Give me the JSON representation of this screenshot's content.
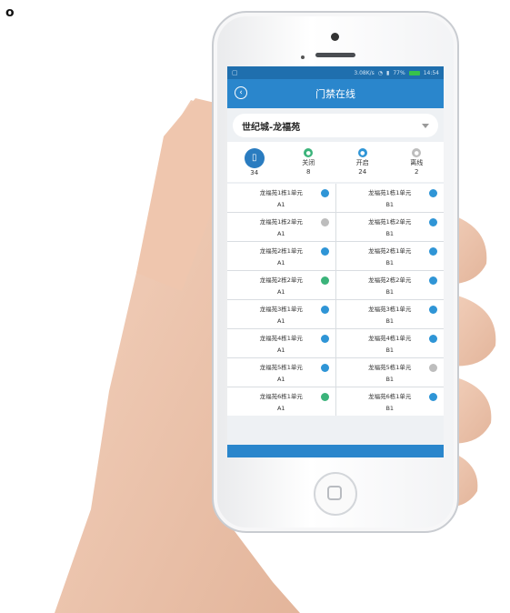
{
  "corner_mark": "o",
  "statusbar": {
    "speed": "3.08K/s",
    "battery_pct": "77%",
    "time": "14:54"
  },
  "navbar": {
    "title": "门禁在线",
    "back_icon": "back-circle-icon"
  },
  "selector": {
    "value": "世纪城-龙福苑"
  },
  "stats": {
    "total": {
      "count": "34",
      "icon": "door-icon"
    },
    "closed": {
      "label": "关闭",
      "count": "8"
    },
    "open": {
      "label": "开启",
      "count": "24"
    },
    "offline": {
      "label": "离线",
      "count": "2"
    }
  },
  "colors": {
    "navbar": "#2a86cc",
    "status_closed": "#3bb37a",
    "status_open": "#2f95d6",
    "status_offline": "#bdbdbd"
  },
  "doors": [
    {
      "name": "龙福苑1栋1单元",
      "code": "A1",
      "status": "open"
    },
    {
      "name": "龙福苑1栋1单元",
      "code": "B1",
      "status": "open"
    },
    {
      "name": "龙福苑1栋2单元",
      "code": "A1",
      "status": "offline"
    },
    {
      "name": "龙福苑1栋2单元",
      "code": "B1",
      "status": "open"
    },
    {
      "name": "龙福苑2栋1单元",
      "code": "A1",
      "status": "open"
    },
    {
      "name": "龙福苑2栋1单元",
      "code": "B1",
      "status": "open"
    },
    {
      "name": "龙福苑2栋2单元",
      "code": "A1",
      "status": "closed"
    },
    {
      "name": "龙福苑2栋2单元",
      "code": "B1",
      "status": "open"
    },
    {
      "name": "龙福苑3栋1单元",
      "code": "A1",
      "status": "open"
    },
    {
      "name": "龙福苑3栋1单元",
      "code": "B1",
      "status": "open"
    },
    {
      "name": "龙福苑4栋1单元",
      "code": "A1",
      "status": "open"
    },
    {
      "name": "龙福苑4栋1单元",
      "code": "B1",
      "status": "open"
    },
    {
      "name": "龙福苑5栋1单元",
      "code": "A1",
      "status": "open"
    },
    {
      "name": "龙福苑5栋1单元",
      "code": "B1",
      "status": "offline"
    },
    {
      "name": "龙福苑6栋1单元",
      "code": "A1",
      "status": "closed"
    },
    {
      "name": "龙福苑6栋1单元",
      "code": "B1",
      "status": "open"
    }
  ]
}
